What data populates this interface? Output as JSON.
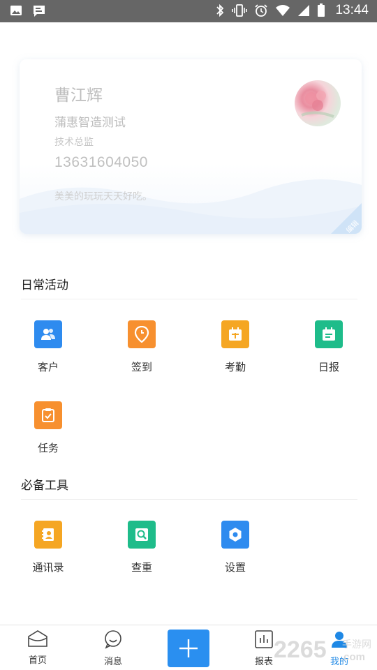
{
  "status_bar": {
    "time": "13:44"
  },
  "profile": {
    "name": "曹江辉",
    "company": "蒲惠智造测试",
    "title": "技术总监",
    "phone": "13631604050",
    "motto": "美美的玩玩天天好吃。",
    "edit_label": "编辑"
  },
  "daily": {
    "title": "日常活动",
    "items": [
      {
        "label": "客户",
        "icon": "customer-icon",
        "color": "#2e8bef"
      },
      {
        "label": "签到",
        "icon": "location-pin-icon",
        "color": "#f7902f"
      },
      {
        "label": "考勤",
        "icon": "calendar-icon",
        "color": "#f5a623"
      },
      {
        "label": "日报",
        "icon": "report-icon",
        "color": "#1ebc8a"
      },
      {
        "label": "任务",
        "icon": "task-icon",
        "color": "#f7902f"
      }
    ]
  },
  "tools": {
    "title": "必备工具",
    "items": [
      {
        "label": "通讯录",
        "icon": "contacts-icon",
        "color": "#f5a623"
      },
      {
        "label": "查重",
        "icon": "duplicate-check-icon",
        "color": "#1ebc8a"
      },
      {
        "label": "设置",
        "icon": "settings-icon",
        "color": "#2e8bef"
      }
    ]
  },
  "nav": {
    "home": "首页",
    "messages": "消息",
    "reports": "报表",
    "mine": "我的"
  },
  "watermark": {
    "brand": "2265",
    "site": "手游网",
    "domain": ".com"
  }
}
